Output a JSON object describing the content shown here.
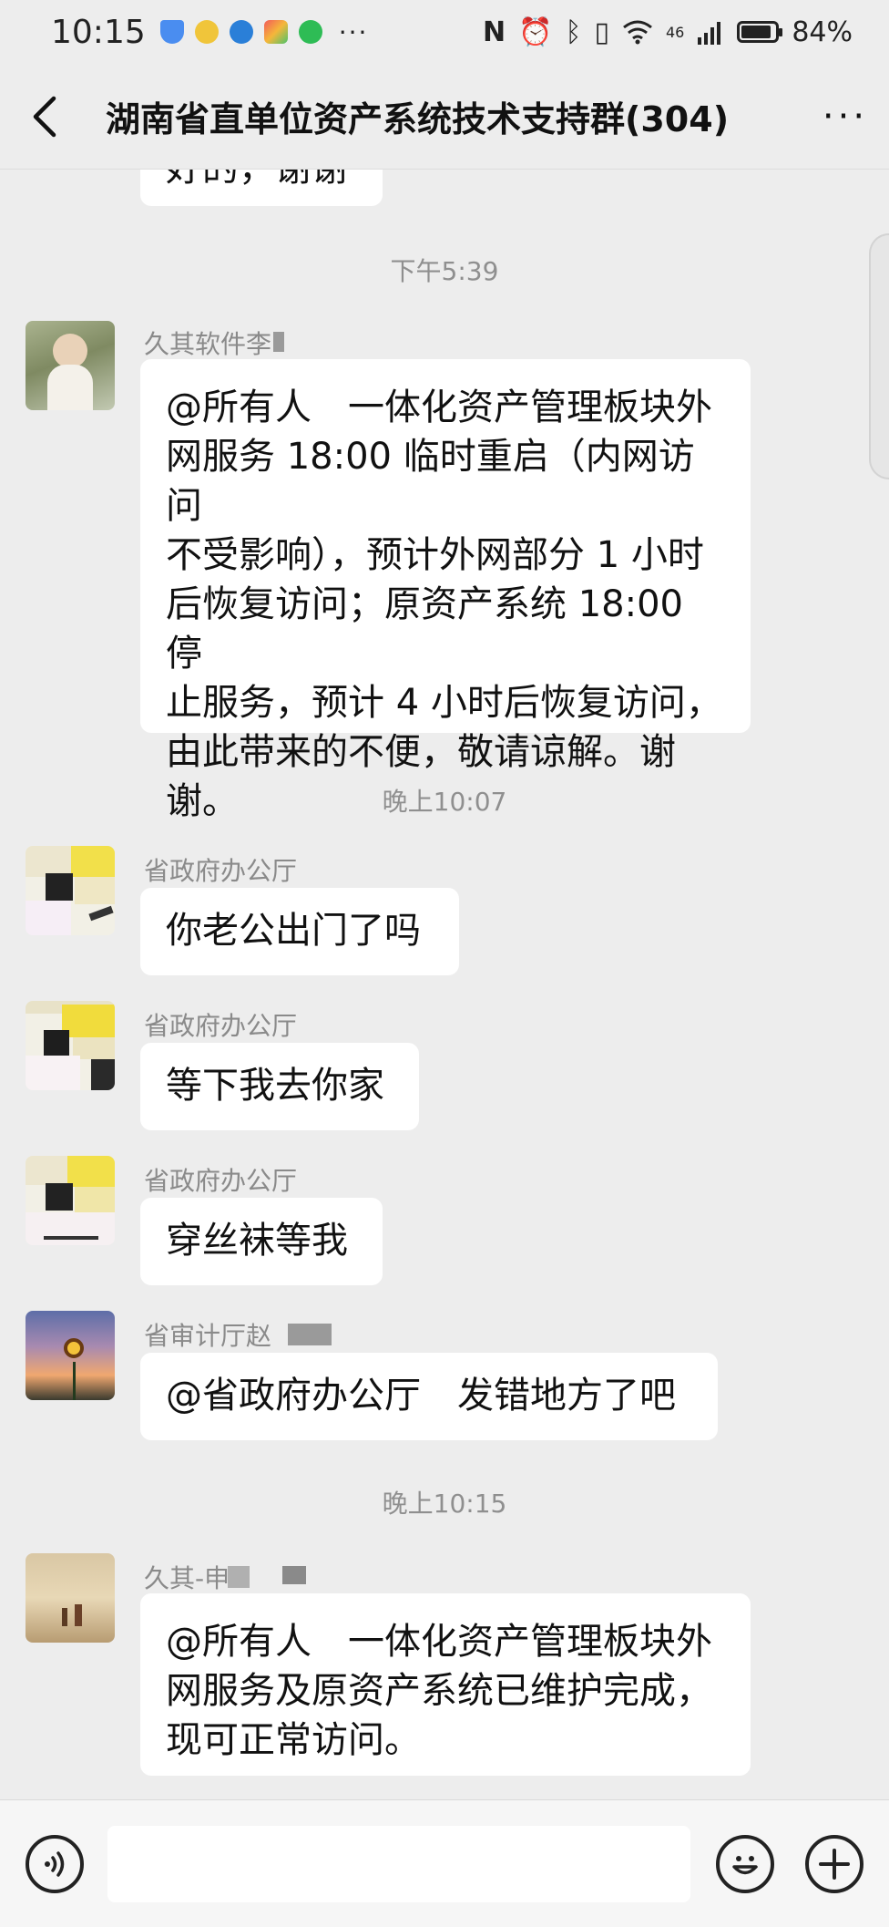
{
  "status_bar": {
    "time": "10:15",
    "network": "46",
    "battery_percent": "84%",
    "overflow": "···"
  },
  "header": {
    "title": "湖南省直单位资产系统技术支持群(304)",
    "more": "···"
  },
  "messages": {
    "partial_top": "好的，谢谢",
    "ts1": "下午5:39",
    "m1_sender": "久其软件李",
    "m1_lines": [
      "@所有人　一体化资产管理板块外",
      "网服务 18:00 临时重启（内网访问",
      "不受影响），预计外网部分 1 小时",
      "后恢复访问；原资产系统 18:00 停",
      "止服务，预计 4 小时后恢复访问，",
      "由此带来的不便，敬请谅解。谢",
      "谢。"
    ],
    "ts2": "晚上10:07",
    "m2_sender": "省政府办公厅",
    "m2_text": "你老公出门了吗",
    "m3_sender": "省政府办公厅",
    "m3_text": "等下我去你家",
    "m4_sender": "省政府办公厅",
    "m4_text": "穿丝袜等我",
    "m5_sender": "省审计厅赵",
    "m5_text": "@省政府办公厅　发错地方了吧",
    "ts3": "晚上10:15",
    "m6_sender": "久其-申",
    "m6_lines": [
      "@所有人　一体化资产管理板块外",
      "网服务及原资产系统已维护完成，",
      "现可正常访问。"
    ]
  },
  "colors": {
    "background": "#ededed",
    "bubble": "#ffffff",
    "meta_text": "#8a8a8a"
  }
}
